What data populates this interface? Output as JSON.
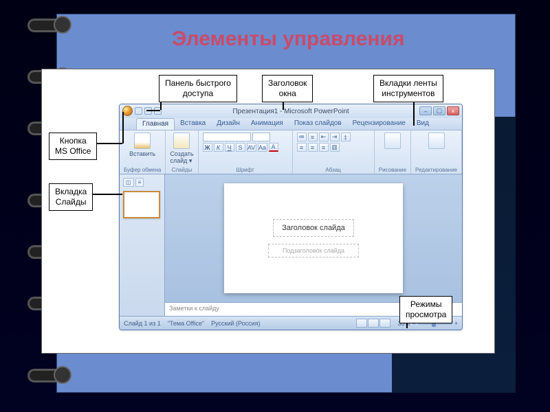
{
  "title": "Элементы управления",
  "callouts": {
    "qat": "Панель быстрого\nдоступа",
    "winTitle": "Заголовок\nокна",
    "ribbonTabs": "Вкладки ленты\nинструментов",
    "officeBtn": "Кнопка\nMS Office",
    "slidesTab": "Вкладка\nСлайды",
    "viewModes": "Режимы\nпросмотра"
  },
  "window": {
    "title": "Презентация1 - Microsoft PowerPoint",
    "tabs": [
      "Главная",
      "Вставка",
      "Дизайн",
      "Анимация",
      "Показ слайдов",
      "Рецензирование",
      "Вид"
    ],
    "groups": {
      "clipboard": {
        "label": "Буфер обмена",
        "btn": "Вставить"
      },
      "slides": {
        "label": "Слайды",
        "btn": "Создать\nслайд ▾"
      },
      "font": {
        "label": "Шрифт"
      },
      "paragraph": {
        "label": "Абзац"
      },
      "drawing": {
        "label": "Рисование"
      },
      "editing": {
        "label": "Редактирование"
      }
    },
    "slide": {
      "titlePlaceholder": "Заголовок слайда",
      "subtitlePlaceholder": "Подзаголовок слайда"
    },
    "notes": "Заметки к слайду",
    "status": {
      "slide": "Слайд 1 из 1",
      "theme": "\"Тема Office\"",
      "lang": "Русский (Россия)",
      "zoom": "38%"
    }
  }
}
